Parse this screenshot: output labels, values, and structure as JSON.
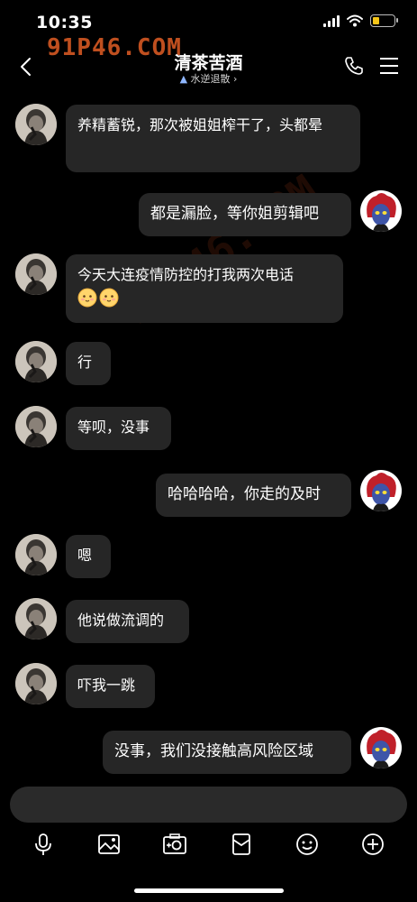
{
  "status": {
    "time": "10:35"
  },
  "watermark": {
    "text": "91P46.COM",
    "diagonal_text": "91P46.COM"
  },
  "header": {
    "title": "清茶苦酒",
    "subtitle": "水逆退散",
    "subtitle_arrow": "›"
  },
  "messages": [
    {
      "side": "left",
      "text": "养精蓄锐，那次被姐姐榨干了，头都晕"
    },
    {
      "side": "right",
      "text": "都是漏脸，等你姐剪辑吧"
    },
    {
      "side": "left",
      "text": "今天大连疫情防控的打我两次电话"
    },
    {
      "side": "left",
      "text": "行"
    },
    {
      "side": "left",
      "text": "等呗，没事"
    },
    {
      "side": "right",
      "text": "哈哈哈哈，你走的及时"
    },
    {
      "side": "left",
      "text": "嗯"
    },
    {
      "side": "left",
      "text": "他说做流调的"
    },
    {
      "side": "left",
      "text": "吓我一跳"
    },
    {
      "side": "right",
      "text": "没事，我们没接触高风险区域"
    }
  ],
  "colors": {
    "bubble": "#262626",
    "background": "#000000",
    "watermark": "#ff6a2a",
    "battery": "#f5c518"
  },
  "icons": [
    "back-icon",
    "phone-icon",
    "menu-icon",
    "mic-icon",
    "image-icon",
    "camera-icon",
    "red-packet-icon",
    "emoji-icon",
    "plus-icon"
  ]
}
